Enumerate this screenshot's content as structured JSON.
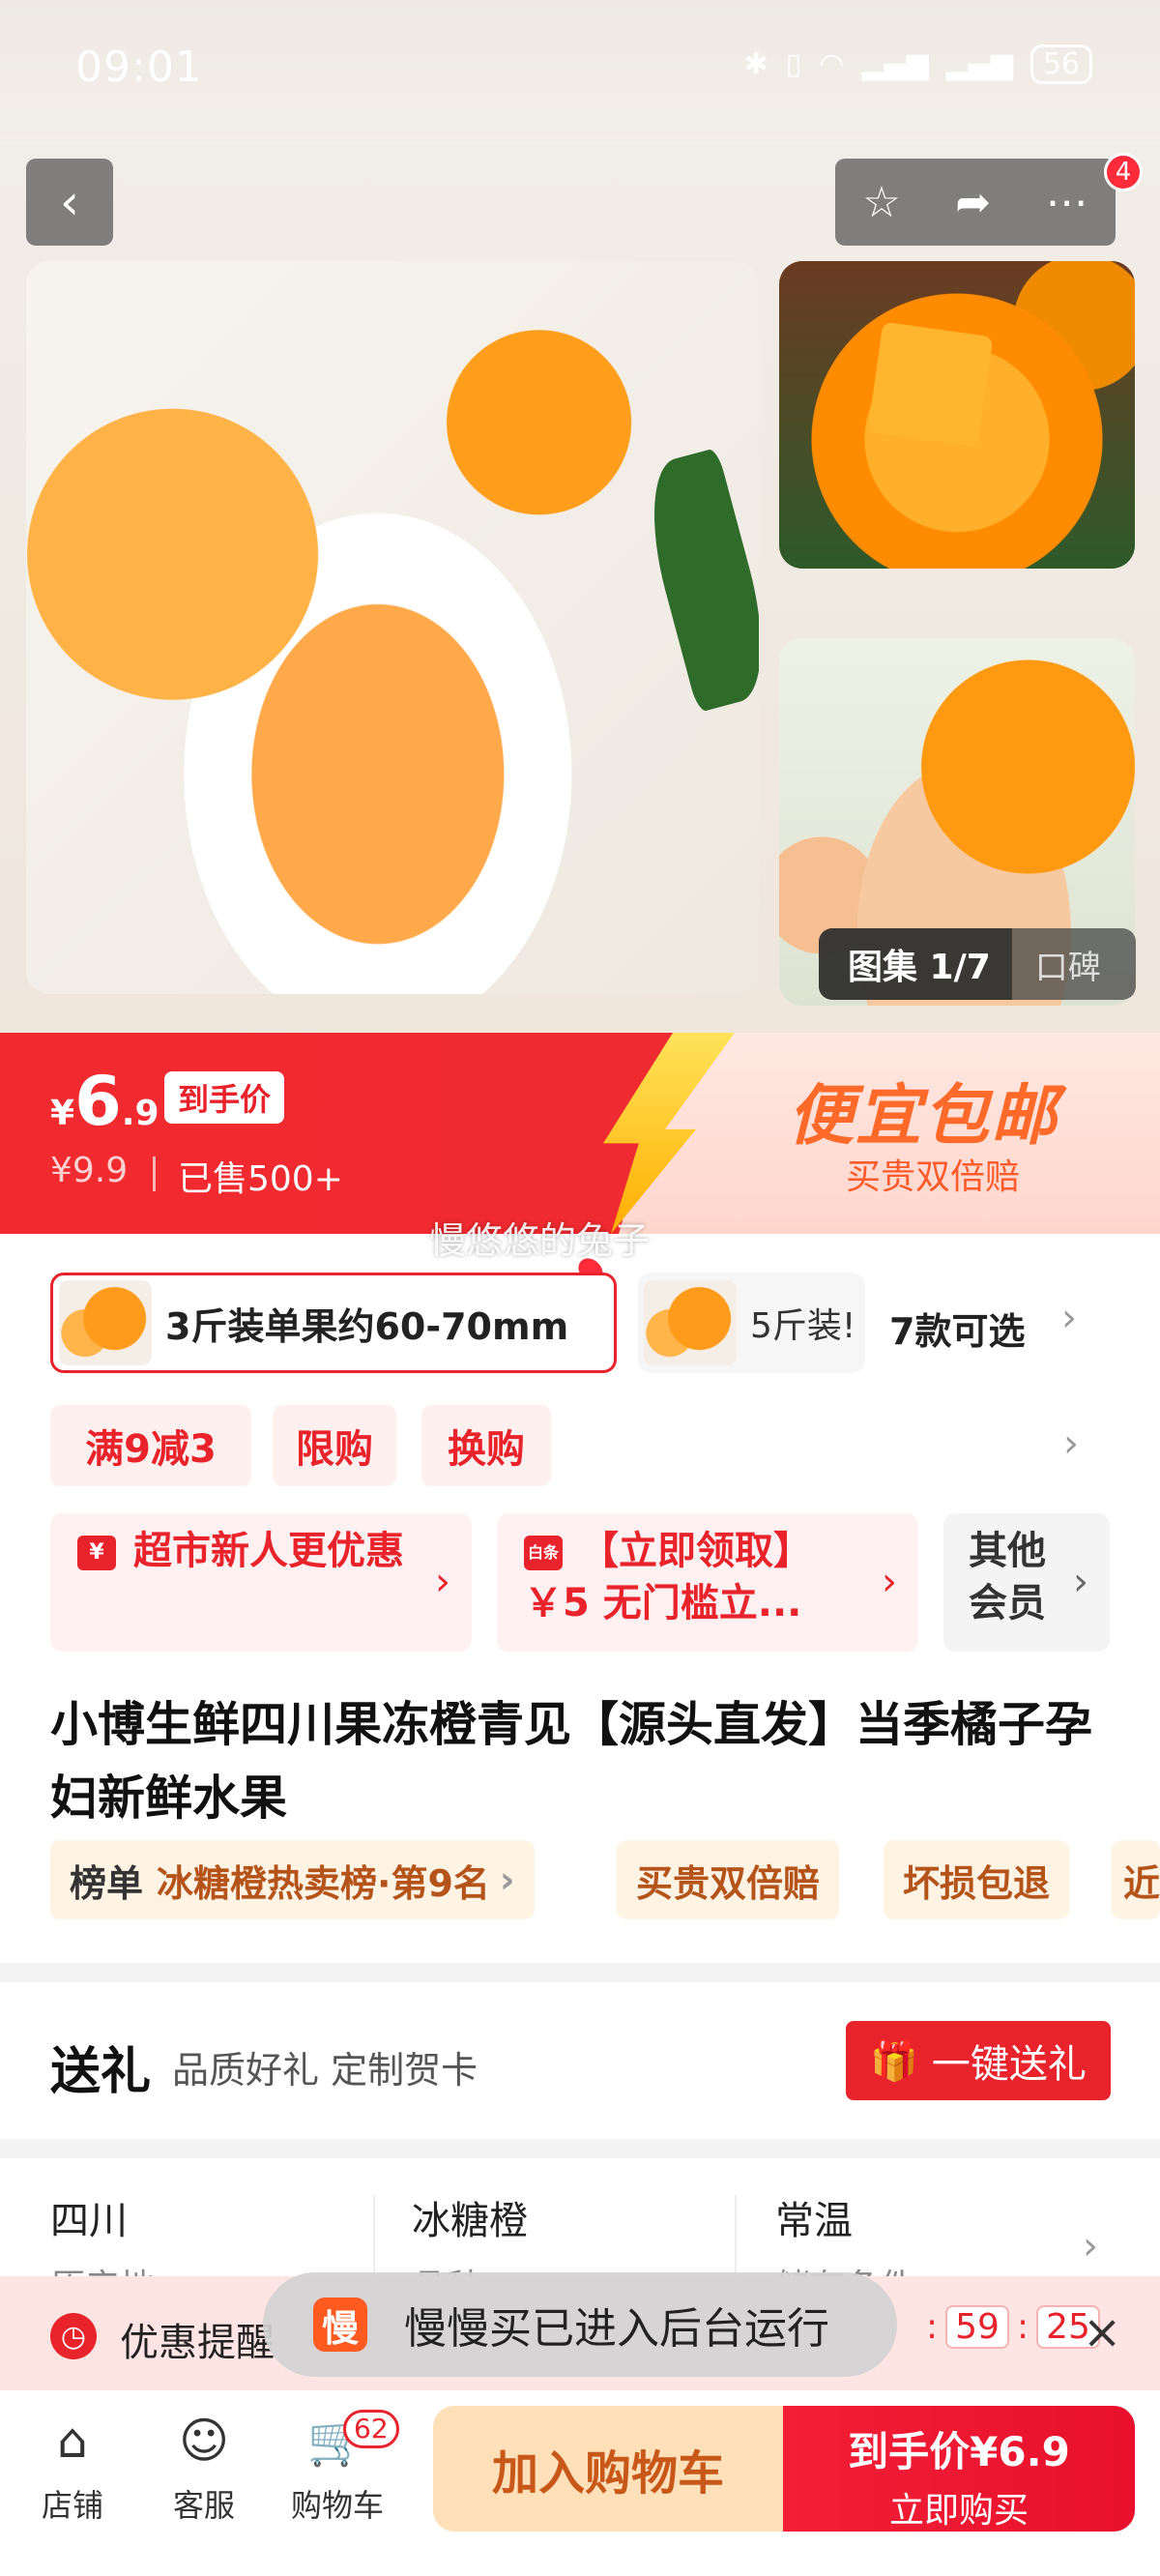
{
  "status": {
    "time": "09:01",
    "battery": "56"
  },
  "gallery": {
    "back_icon": "chevron-left-icon",
    "cart_badge": "4",
    "album_label": "图集 1/7",
    "reviews_label": "口碑"
  },
  "price": {
    "currency": "¥",
    "integer": "6",
    "decimal": ".9",
    "tag": "到手价",
    "original": "¥9.9",
    "sold": "已售500+",
    "promo_title": "便宜包邮",
    "promo_sub": "买贵双倍赔"
  },
  "watermark": "慢悠悠的兔子",
  "sku": {
    "selected": "3斤装单果约60-70mm",
    "other": "5斤装!",
    "more": "7款可选"
  },
  "tags": [
    "满9减3",
    "限购",
    "换购"
  ],
  "coupons": [
    {
      "icon": "¥",
      "text": "超市新人更优惠"
    },
    {
      "icon": "白条",
      "text": "【立即领取】￥5 无门槛立..."
    },
    {
      "text": "其他会员"
    }
  ],
  "product_title": "小博生鲜四川果冻橙青见【源头直发】当季橘子孕妇新鲜水果",
  "badges": {
    "rank_prefix": "榜单",
    "rank": "冰糖橙热卖榜·第9名",
    "b2": "买贵双倍赔",
    "b3": "坏损包退",
    "b4": "近"
  },
  "gift": {
    "title": "送礼",
    "subtitle": "品质好礼 定制贺卡",
    "button": "一键送礼"
  },
  "attrs": [
    {
      "value": "四川",
      "label": "原产地"
    },
    {
      "value": "冰糖橙",
      "label": "品种"
    },
    {
      "value": "常温",
      "label": "储存条件"
    }
  ],
  "reminder": {
    "text": "优惠提醒",
    "countdown": [
      ":",
      "59",
      ":",
      "25"
    ]
  },
  "toast": {
    "icon": "慢",
    "text": "慢慢买已进入后台运行"
  },
  "bottom": {
    "store": "店铺",
    "service": "客服",
    "cart": "购物车",
    "cart_count": "62",
    "add_cart": "加入购物车",
    "buy_price": "到手价¥6.9",
    "buy_now": "立即购买"
  }
}
